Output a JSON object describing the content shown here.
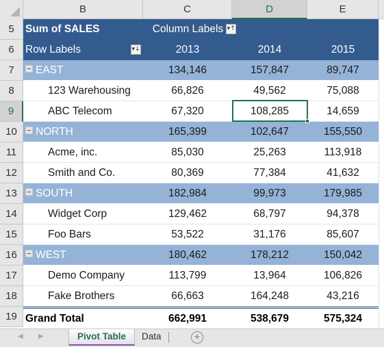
{
  "columns": [
    "B",
    "C",
    "D",
    "E"
  ],
  "selected_column": "D",
  "selected_row": "9",
  "selected_cell_value": "108,285",
  "pivot": {
    "title": "Sum of SALES",
    "column_labels": "Column Labels",
    "row_labels": "Row Labels",
    "years": [
      "2013",
      "2014",
      "2015"
    ],
    "header_row_numbers": [
      "5",
      "6"
    ],
    "groups": [
      {
        "row": "7",
        "name": "EAST",
        "values": [
          "134,146",
          "157,847",
          "89,747"
        ],
        "items": [
          {
            "row": "8",
            "name": "123 Warehousing",
            "values": [
              "66,826",
              "49,562",
              "75,088"
            ]
          },
          {
            "row": "9",
            "name": "ABC Telecom",
            "values": [
              "67,320",
              "108,285",
              "14,659"
            ]
          }
        ]
      },
      {
        "row": "10",
        "name": "NORTH",
        "values": [
          "165,399",
          "102,647",
          "155,550"
        ],
        "items": [
          {
            "row": "11",
            "name": "Acme, inc.",
            "values": [
              "85,030",
              "25,263",
              "113,918"
            ]
          },
          {
            "row": "12",
            "name": "Smith and Co.",
            "values": [
              "80,369",
              "77,384",
              "41,632"
            ]
          }
        ]
      },
      {
        "row": "13",
        "name": "SOUTH",
        "values": [
          "182,984",
          "99,973",
          "179,985"
        ],
        "items": [
          {
            "row": "14",
            "name": "Widget Corp",
            "values": [
              "129,462",
              "68,797",
              "94,378"
            ]
          },
          {
            "row": "15",
            "name": "Foo Bars",
            "values": [
              "53,522",
              "31,176",
              "85,607"
            ]
          }
        ]
      },
      {
        "row": "16",
        "name": "WEST",
        "values": [
          "180,462",
          "178,212",
          "150,042"
        ],
        "items": [
          {
            "row": "17",
            "name": "Demo Company",
            "values": [
              "113,799",
              "13,964",
              "106,826"
            ]
          },
          {
            "row": "18",
            "name": "Fake Brothers",
            "values": [
              "66,663",
              "164,248",
              "43,216"
            ]
          }
        ]
      }
    ],
    "grand_total": {
      "row": "19",
      "label": "Grand Total",
      "values": [
        "662,991",
        "538,679",
        "575,324"
      ]
    }
  },
  "sheet_tabs": [
    {
      "label": "Pivot Table",
      "active": true
    },
    {
      "label": "Data",
      "active": false
    }
  ],
  "icons": {
    "sort_filter": "▾↓",
    "sort_filter_col": "▾↑",
    "add_sheet": "+",
    "nav_prev": "◀",
    "nav_next": "▶"
  },
  "colors": {
    "header_fill": "#335b8e",
    "region_fill": "#95b3d7",
    "selection": "#217346"
  }
}
